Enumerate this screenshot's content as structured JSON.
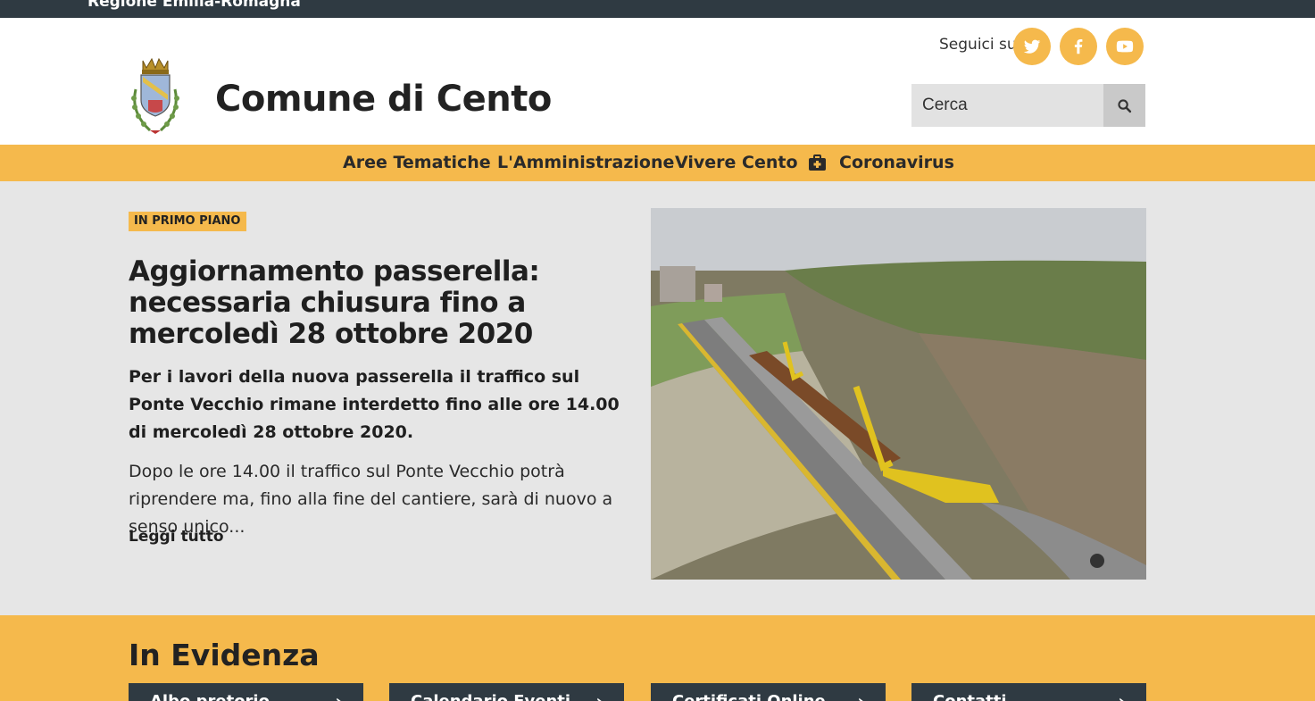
{
  "topbar": {
    "label": "Regione Emilia-Romagna"
  },
  "header": {
    "title": "Comune di Cento",
    "follow_label": "Seguici su",
    "social": [
      {
        "icon": "twitter-icon"
      },
      {
        "icon": "facebook-icon"
      },
      {
        "icon": "youtube-icon"
      }
    ],
    "search": {
      "placeholder": "Cerca",
      "icon": "search-icon"
    }
  },
  "nav": {
    "items": [
      {
        "label": "Aree Tematiche"
      },
      {
        "label": "L'Amministrazione"
      },
      {
        "label": "Vivere Cento"
      },
      {
        "label": "Coronavirus",
        "icon": "first-aid-kit-icon"
      }
    ]
  },
  "hero": {
    "badge": "IN PRIMO PIANO",
    "title": "Aggiornamento passerella: necessaria chiusura fino a mercoledì 28 ottobre 2020",
    "lead": "Per i lavori della nuova passerella il traffico sul Ponte Vecchio rimane interdetto fino alle ore 14.00 di mercoledì 28 ottobre 2020.",
    "body": "Dopo le ore 14.00 il traffico sul Ponte Vecchio potrà riprendere ma, fino alla fine del cantiere, sarà di nuovo a senso unico...",
    "read_more": "Leggi tutto"
  },
  "evidenza": {
    "title": "In Evidenza",
    "cards": [
      {
        "label": "Albo pretorio"
      },
      {
        "label": "Calendario Eventi"
      },
      {
        "label": "Certificati Online"
      },
      {
        "label": "Contatti"
      }
    ]
  },
  "colors": {
    "accent": "#f5b94c",
    "dark": "#2f3a42",
    "hero_bg": "#e6e6e6"
  }
}
